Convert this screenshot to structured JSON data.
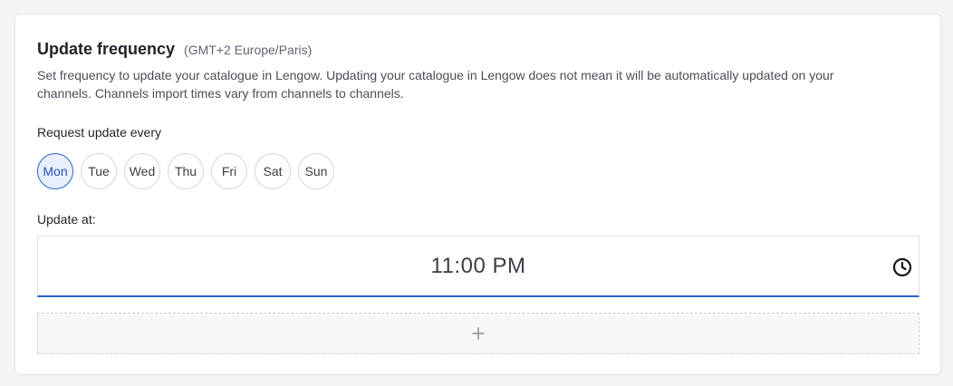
{
  "section": {
    "title": "Update frequency",
    "timezone": "(GMT+2 Europe/Paris)",
    "description": "Set frequency to update your catalogue in Lengow. Updating your catalogue in Lengow does not mean it will be automatically updated on your channels. Channels import times vary from channels to channels."
  },
  "schedule": {
    "request_label": "Request update every",
    "days": [
      {
        "label": "Mon",
        "selected": true
      },
      {
        "label": "Tue",
        "selected": false
      },
      {
        "label": "Wed",
        "selected": false
      },
      {
        "label": "Thu",
        "selected": false
      },
      {
        "label": "Fri",
        "selected": false
      },
      {
        "label": "Sat",
        "selected": false
      },
      {
        "label": "Sun",
        "selected": false
      }
    ],
    "update_at_label": "Update at:",
    "time_value": "11:00 PM"
  },
  "icons": {
    "time_field": "clock-icon",
    "add_row": "plus-icon"
  },
  "colors": {
    "accent": "#2563c9",
    "selected_day_background": "#e9f0fb"
  }
}
